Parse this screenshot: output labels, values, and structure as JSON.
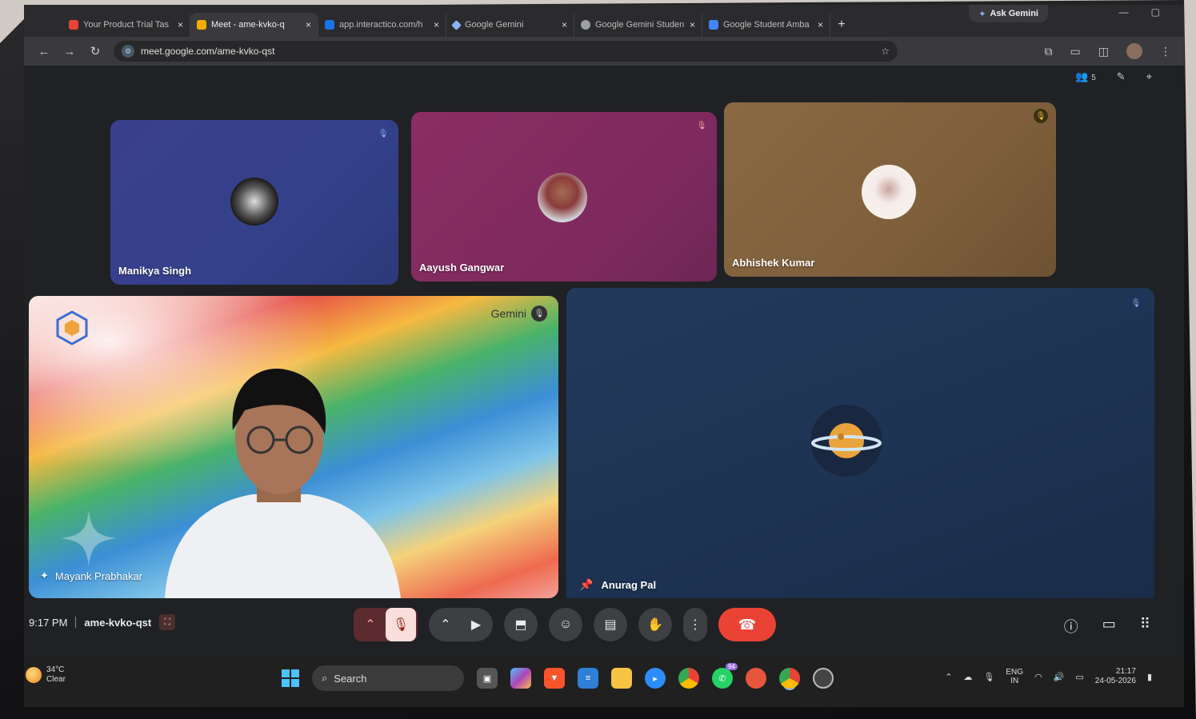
{
  "browser": {
    "tabs": [
      {
        "title": "Your Product Trial Tas",
        "favicon_color": "#ea4335",
        "active": false
      },
      {
        "title": "Meet - ame-kvko-q",
        "favicon_color": "#f9ab00",
        "active": true
      },
      {
        "title": "app.interactico.com/h",
        "favicon_color": "#1a73e8",
        "active": false
      },
      {
        "title": "Google Gemini",
        "favicon_color": "#8ab4f8",
        "active": false
      },
      {
        "title": "Google Gemini Studen",
        "favicon_color": "#9aa0a6",
        "active": false
      },
      {
        "title": "Google Student Amba",
        "favicon_color": "#4285f4",
        "active": false
      }
    ],
    "ask_gemini": "Ask Gemini",
    "url": "meet.google.com/ame-kvko-qst",
    "participant_count": "5"
  },
  "meet": {
    "participants": [
      {
        "name": "Manikya Singh",
        "bg": "#3b3f8c"
      },
      {
        "name": "Aayush Gangwar",
        "bg": "#8b2d63"
      },
      {
        "name": "Abhishek Kumar",
        "bg": "#8a6843"
      },
      {
        "name": "Mayank Prabhakar",
        "bg": "#e64f45"
      },
      {
        "name": "Anurag Pal",
        "bg": "#23395c"
      }
    ],
    "gemini_logo_text": "Gemini",
    "time": "9:17 PM",
    "meeting_code": "ame-kvko-qst",
    "controls": {
      "mic": "mic-off-icon",
      "camera": "camera-icon",
      "present": "present-icon",
      "reactions": "emoji-icon",
      "captions": "captions-icon",
      "hand": "hand-icon",
      "more": "more-icon",
      "end_call": "end-call-icon"
    },
    "end_call_color": "#ea4335"
  },
  "taskbar": {
    "weather_temp": "34°C",
    "weather_desc": "Clear",
    "search_label": "Search",
    "whatsapp_badge": "94",
    "lang_line1": "ENG",
    "lang_line2": "IN",
    "clock_time": "21:17",
    "clock_date": "24-05-2026"
  }
}
